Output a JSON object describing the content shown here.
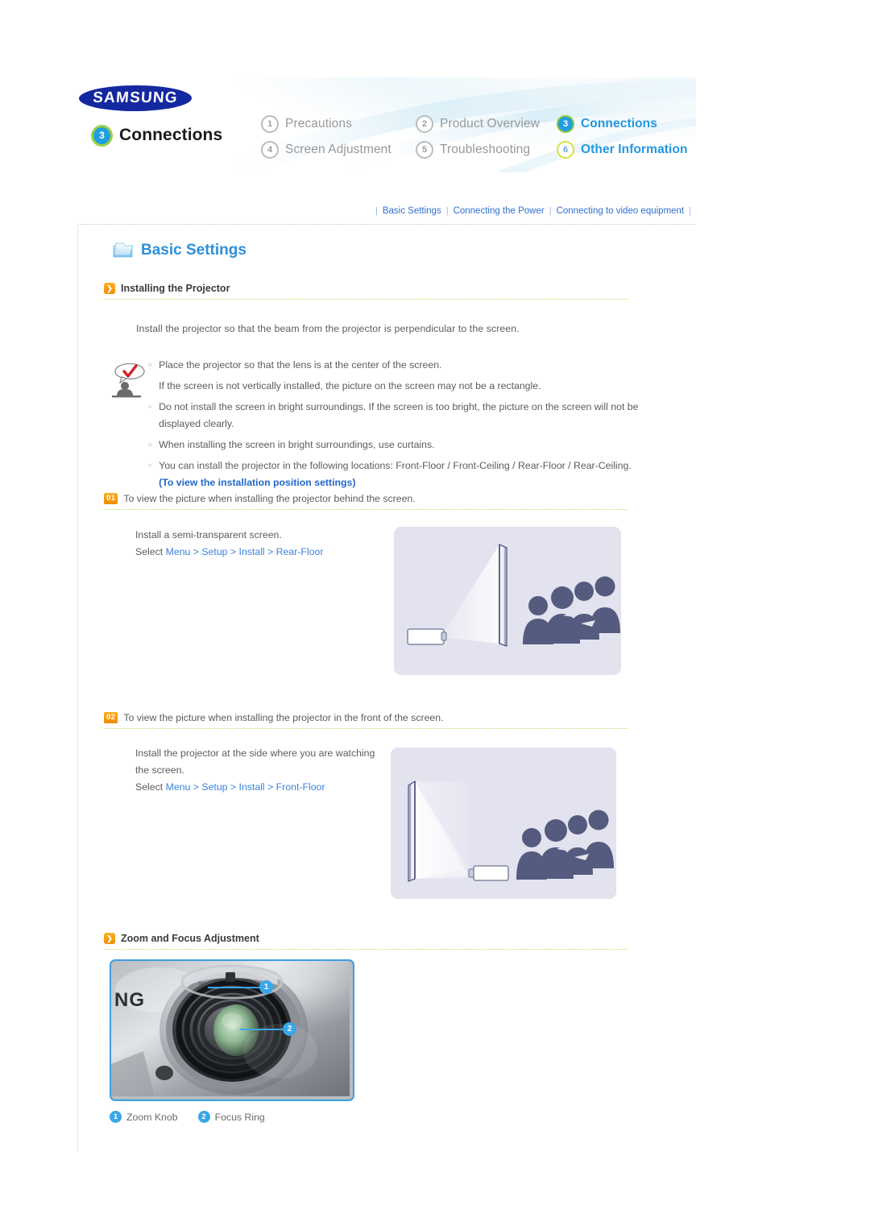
{
  "header": {
    "brand": "SAMSUNG",
    "section_number": "3",
    "section_title": "Connections",
    "nav": [
      {
        "num": "1",
        "label": "Precautions",
        "state": "inactive"
      },
      {
        "num": "2",
        "label": "Product Overview",
        "state": "inactive"
      },
      {
        "num": "3",
        "label": "Connections",
        "state": "active"
      },
      {
        "num": "4",
        "label": "Screen Adjustment",
        "state": "inactive"
      },
      {
        "num": "5",
        "label": "Troubleshooting",
        "state": "inactive"
      },
      {
        "num": "6",
        "label": "Other Information",
        "state": "highlight"
      }
    ]
  },
  "subnav": {
    "items": [
      "Basic Settings",
      "Connecting the Power",
      "Connecting to video equipment"
    ]
  },
  "page": {
    "heading": "Basic Settings",
    "heading_icon": "folder-icon"
  },
  "installing": {
    "sub_heading": "Installing the Projector",
    "intro": "Install the projector so that the beam from the projector is perpendicular to the screen.",
    "notes": [
      {
        "chev": true,
        "text": "Place the projector so that the lens is at the center of the screen."
      },
      {
        "chev": false,
        "text": "If the screen is not vertically installed, the picture on the screen may not be a rectangle."
      },
      {
        "chev": true,
        "text": "Do not install the screen in bright surroundings. If the screen is too bright, the picture on the screen will not be"
      },
      {
        "chev": false,
        "text": "displayed clearly."
      },
      {
        "chev": true,
        "text": "When installing the screen in bright surroundings, use curtains."
      },
      {
        "chev": true,
        "text": "You can install the projector in the following locations: Front-Floor / Front-Ceiling / Rear-Floor / Rear-Ceiling."
      }
    ],
    "note_link": "(To view the installation position settings)"
  },
  "step01": {
    "num": "01",
    "title": "To view the picture when installing the projector behind the screen.",
    "line1": "Install a semi-transparent screen.",
    "select_label": "Select",
    "path": "Menu > Setup > Install > Rear-Floor",
    "figure": "rear-floor-projection-diagram"
  },
  "step02": {
    "num": "02",
    "title": "To view the picture when installing the projector in the front of the screen.",
    "line1": "Install the projector at the side where you are watching",
    "line2": "the screen.",
    "select_label": "Select",
    "path": "Menu > Setup > Install > Front-Floor",
    "figure": "front-floor-projection-diagram"
  },
  "zoomfocus": {
    "sub_heading": "Zoom and Focus Adjustment",
    "photo": "projector-lens-photo",
    "callouts": [
      {
        "num": "1",
        "label": "Zoom Knob"
      },
      {
        "num": "2",
        "label": "Focus Ring"
      }
    ]
  },
  "colors": {
    "accent_blue": "#2196e3",
    "link_blue": "#2f6fd0",
    "orange": "#f08c00",
    "green_rule": "#b9d96a",
    "badge_green_ring": "#9ccf4a",
    "samsung_navy": "#1428a0",
    "illustration_bg": "#e2e3ef",
    "silhouette": "#555b7e"
  }
}
